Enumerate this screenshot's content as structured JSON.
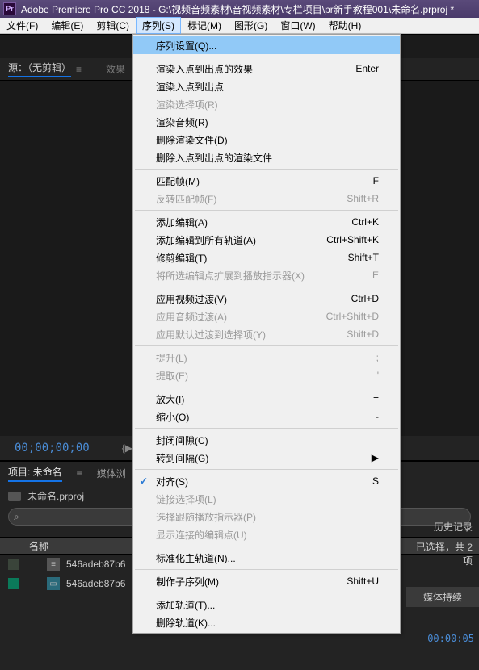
{
  "titlebar": {
    "app_icon_text": "Pr",
    "title": "Adobe Premiere Pro CC 2018 - G:\\视频音频素材\\音视频素材\\专栏项目\\pr新手教程001\\未命名.prproj *"
  },
  "menubar": {
    "items": [
      {
        "label": "文件(F)"
      },
      {
        "label": "编辑(E)"
      },
      {
        "label": "剪辑(C)"
      },
      {
        "label": "序列(S)",
        "open": true
      },
      {
        "label": "标记(M)"
      },
      {
        "label": "图形(G)"
      },
      {
        "label": "窗口(W)"
      },
      {
        "label": "帮助(H)"
      }
    ]
  },
  "source": {
    "tab": "源：（无剪辑）",
    "menu_glyph": "≡",
    "fx_label": "效果"
  },
  "timecode": {
    "value": "00;00;00;00",
    "icon_glyph": "{▶"
  },
  "panels": {
    "project_tab": "项目: 未命名",
    "media_tab": "媒体浏",
    "history_tab": "历史记录"
  },
  "project": {
    "name": "未命名.prproj",
    "search_glyph": "⌕",
    "selected_text": "已选择，共 2 项",
    "col_name": "名称",
    "col_duration": "媒体持续",
    "rows": [
      {
        "name": "546adeb87b6",
        "icon": "≡",
        "variant": "av"
      },
      {
        "name": "546adeb87b6",
        "icon": "▭",
        "variant": "teal"
      }
    ],
    "small_tc": "00:00:05"
  },
  "playicons": {
    "a": "▶",
    "b": "▶|",
    "c": "⏏"
  },
  "dropdown": {
    "groups": [
      [
        {
          "label": "序列设置(Q)...",
          "highlight": true
        }
      ],
      [
        {
          "label": "渲染入点到出点的效果",
          "shortcut": "Enter"
        },
        {
          "label": "渲染入点到出点"
        },
        {
          "label": "渲染选择项(R)",
          "disabled": true
        },
        {
          "label": "渲染音频(R)"
        },
        {
          "label": "删除渲染文件(D)"
        },
        {
          "label": "删除入点到出点的渲染文件"
        }
      ],
      [
        {
          "label": "匹配帧(M)",
          "shortcut": "F"
        },
        {
          "label": "反转匹配帧(F)",
          "shortcut": "Shift+R",
          "disabled": true
        }
      ],
      [
        {
          "label": "添加编辑(A)",
          "shortcut": "Ctrl+K"
        },
        {
          "label": "添加编辑到所有轨道(A)",
          "shortcut": "Ctrl+Shift+K"
        },
        {
          "label": "修剪编辑(T)",
          "shortcut": "Shift+T"
        },
        {
          "label": "将所选编辑点扩展到播放指示器(X)",
          "shortcut": "E",
          "disabled": true
        }
      ],
      [
        {
          "label": "应用视频过渡(V)",
          "shortcut": "Ctrl+D"
        },
        {
          "label": "应用音频过渡(A)",
          "shortcut": "Ctrl+Shift+D",
          "disabled": true
        },
        {
          "label": "应用默认过渡到选择项(Y)",
          "shortcut": "Shift+D",
          "disabled": true
        }
      ],
      [
        {
          "label": "提升(L)",
          "shortcut": ";",
          "disabled": true
        },
        {
          "label": "提取(E)",
          "shortcut": "'",
          "disabled": true
        }
      ],
      [
        {
          "label": "放大(I)",
          "shortcut": "="
        },
        {
          "label": "缩小(O)",
          "shortcut": "-"
        }
      ],
      [
        {
          "label": "封闭间隙(C)"
        },
        {
          "label": "转到间隔(G)",
          "submenu": true
        }
      ],
      [
        {
          "label": "对齐(S)",
          "shortcut": "S",
          "checked": true
        },
        {
          "label": "链接选择项(L)",
          "disabled": true
        },
        {
          "label": "选择跟随播放指示器(P)",
          "disabled": true
        },
        {
          "label": "显示连接的编辑点(U)",
          "disabled": true
        }
      ],
      [
        {
          "label": "标准化主轨道(N)..."
        }
      ],
      [
        {
          "label": "制作子序列(M)",
          "shortcut": "Shift+U"
        }
      ],
      [
        {
          "label": "添加轨道(T)..."
        },
        {
          "label": "删除轨道(K)..."
        }
      ]
    ]
  }
}
